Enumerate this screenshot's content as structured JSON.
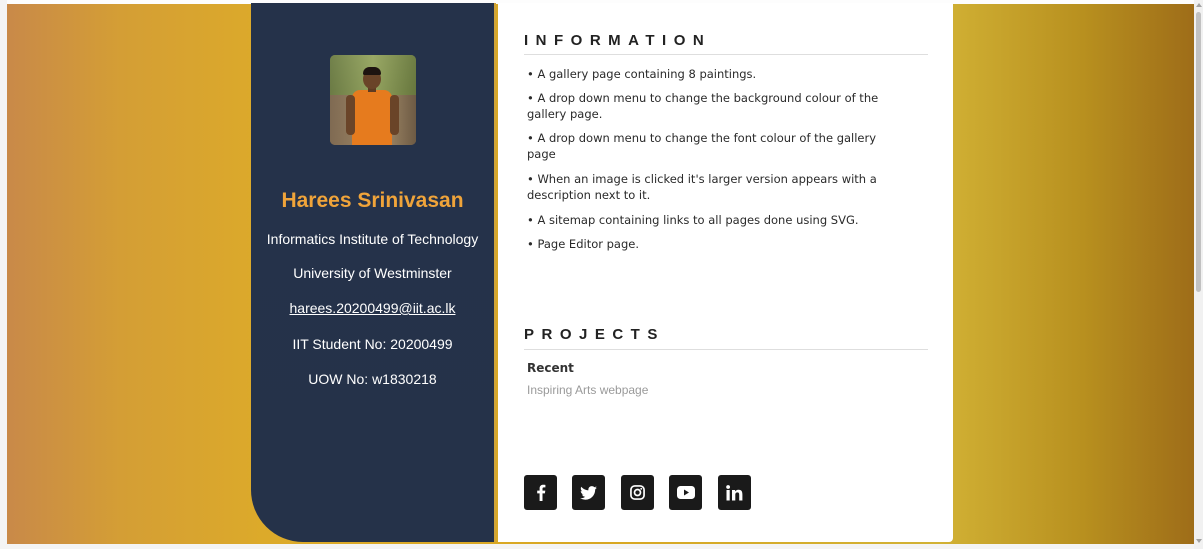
{
  "profile": {
    "name": "Harees Srinivasan",
    "institute": "Informatics Institute of Technology",
    "university": "University of Westminster",
    "email": "harees.20200499@iit.ac.lk",
    "iit_no": "IIT Student No: 20200499",
    "uow_no": "UOW No: w1830218"
  },
  "information": {
    "title": "INFORMATION",
    "items": [
      "• A gallery page containing 8 paintings.",
      "• A drop down menu to change the background colour of the gallery page.",
      "• A drop down menu to change the font colour of the gallery page",
      "• When an image is clicked it's larger version appears with a description next to it.",
      "• A sitemap containing links to all pages done using SVG.",
      "• Page Editor page."
    ]
  },
  "projects": {
    "title": "PROJECTS",
    "recent_label": "Recent",
    "recent_item": "Inspiring Arts webpage"
  },
  "socials": [
    "facebook-icon",
    "twitter-icon",
    "instagram-icon",
    "youtube-icon",
    "linkedin-icon"
  ],
  "colors": {
    "sidebar": "#253249",
    "name_accent": "#f0a43a",
    "social_bg": "#1a1a1a"
  }
}
